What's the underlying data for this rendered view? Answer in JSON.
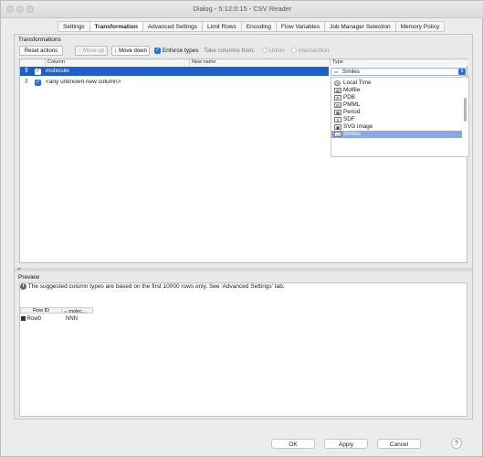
{
  "window": {
    "title": "Dialog - 5:12:0:15 - CSV Reader"
  },
  "tabs": [
    {
      "label": "Settings"
    },
    {
      "label": "Transformation"
    },
    {
      "label": "Advanced Settings"
    },
    {
      "label": "Limit Rows"
    },
    {
      "label": "Encoding"
    },
    {
      "label": "Flow Variables"
    },
    {
      "label": "Job Manager Selection"
    },
    {
      "label": "Memory Policy"
    }
  ],
  "active_tab": "Transformation",
  "transformations": {
    "section_title": "Transformations",
    "reset_label": "Reset actions",
    "move_up_label": "Move up",
    "move_down_label": "Move down",
    "enforce_types_label": "Enforce types",
    "enforce_types_checked": true,
    "take_columns_label": "Take columns from:",
    "union_label": "Union",
    "intersection_label": "Intersection",
    "headers": {
      "column": "Column",
      "new_name": "New name",
      "type": "Type"
    },
    "rows": [
      {
        "column": "molecule",
        "new_name": "",
        "type": "Smiles",
        "selected": true,
        "checked": true
      },
      {
        "column": "<any unknown new column>",
        "new_name": "",
        "type": "",
        "selected": false,
        "checked": true
      }
    ],
    "type_combo_value": "Smiles",
    "type_options": [
      {
        "label": "Local Time",
        "icon": "clock-icon"
      },
      {
        "label": "Molfile",
        "icon": "molfile-icon"
      },
      {
        "label": "PDB",
        "icon": "pdb-icon"
      },
      {
        "label": "PMML",
        "icon": "pmml-icon"
      },
      {
        "label": "Period",
        "icon": "period-icon"
      },
      {
        "label": "SDF",
        "icon": "sdf-icon"
      },
      {
        "label": "SVG image",
        "icon": "svg-icon"
      },
      {
        "label": "Smiles",
        "icon": "smiles-icon",
        "selected": true
      }
    ]
  },
  "preview": {
    "section_title": "Preview",
    "info_text": "The suggested column types are based on the first 10000 rows only. See 'Advanced Settings' tab.",
    "headers": {
      "row_id": "Row ID",
      "col": "molec..."
    },
    "rows": [
      {
        "id": "Row0",
        "value": "NNN"
      }
    ]
  },
  "buttons": {
    "ok": "OK",
    "apply": "Apply",
    "cancel": "Cancel",
    "help": "?"
  }
}
